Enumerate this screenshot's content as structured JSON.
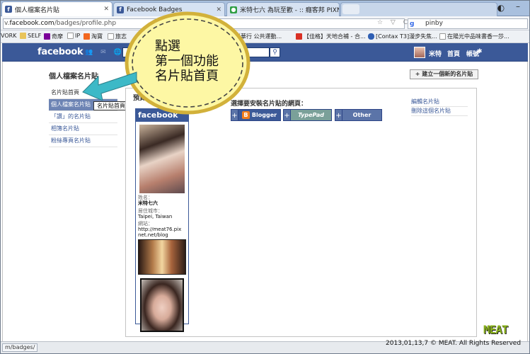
{
  "browser": {
    "tabs": [
      {
        "label": "個人檔案名片貼",
        "active": true
      },
      {
        "label": "Facebook Badges",
        "active": false
      },
      {
        "label": "米特七六 為玩至歡 - :: 癮客邦 PIXNE...",
        "active": false
      }
    ],
    "url_prefix": "v.",
    "url_domain": "facebook.com",
    "url_path": "/badges/profile.php",
    "url_ctrls": "☆ ▽ C",
    "search_value": "pinby",
    "search_engine_icon": "google-icon",
    "bookmarks": [
      {
        "label": "VORK"
      },
      {
        "label": "SELF"
      },
      {
        "label": "奇摩"
      },
      {
        "label": "IP"
      },
      {
        "label": "淘寶"
      },
      {
        "label": "旅志"
      },
      {
        "label": "光華行 公共運動..."
      },
      {
        "label": "【佳格】天地合補 - 合..."
      },
      {
        "label": "[Contax T3]漫步失焦..."
      },
      {
        "label": "在陽光中品味書香一莎..."
      }
    ]
  },
  "facebook": {
    "logo": "facebook",
    "nav": {
      "user_name": "米特",
      "home": "首頁",
      "account": "帳號"
    },
    "page_title": "個人檔案名片貼",
    "create_button": "+ 建立一個新的名片貼",
    "sidebar": [
      {
        "label": "名片貼首頁",
        "selected": false
      },
      {
        "label": "個人檔案名片貼",
        "selected": true
      },
      {
        "label": "「讚」的名片貼",
        "selected": false
      },
      {
        "label": "相簿名片貼",
        "selected": false
      },
      {
        "label": "粉絲專頁名片貼",
        "selected": false
      }
    ],
    "tooltip": "名片貼首頁",
    "preview_label": "預覽",
    "install_label": "選擇要安裝名片貼的網頁：",
    "install_targets": [
      {
        "label": "Blogger",
        "icon": "blogger-icon"
      },
      {
        "label": "TypePad",
        "icon": "typepad-icon"
      },
      {
        "label": "Other",
        "icon": ""
      }
    ],
    "side_links": [
      "編輯名片貼",
      "刪除這個名片貼"
    ],
    "badge": {
      "header": "facebook",
      "name_label": "姓名：",
      "name_value": "米特七六",
      "city_label": "居住城市：",
      "city_value": "Taipei, Taiwan",
      "site_label": "網站：",
      "site_value_1": "http://meat76.pix",
      "site_value_2": "net.net/blog"
    }
  },
  "callout": {
    "lines": [
      "點選",
      "第一個功能",
      "名片貼首頁"
    ],
    "bubble_fill": "#fdf7a4",
    "arrow_color": "#3db9c7"
  },
  "status_bar": {
    "url": "m/badges/"
  },
  "watermark": {
    "logo": "MEAT",
    "copyright": "2013,01,13,7 © MEAT. All Rights Reserved"
  }
}
